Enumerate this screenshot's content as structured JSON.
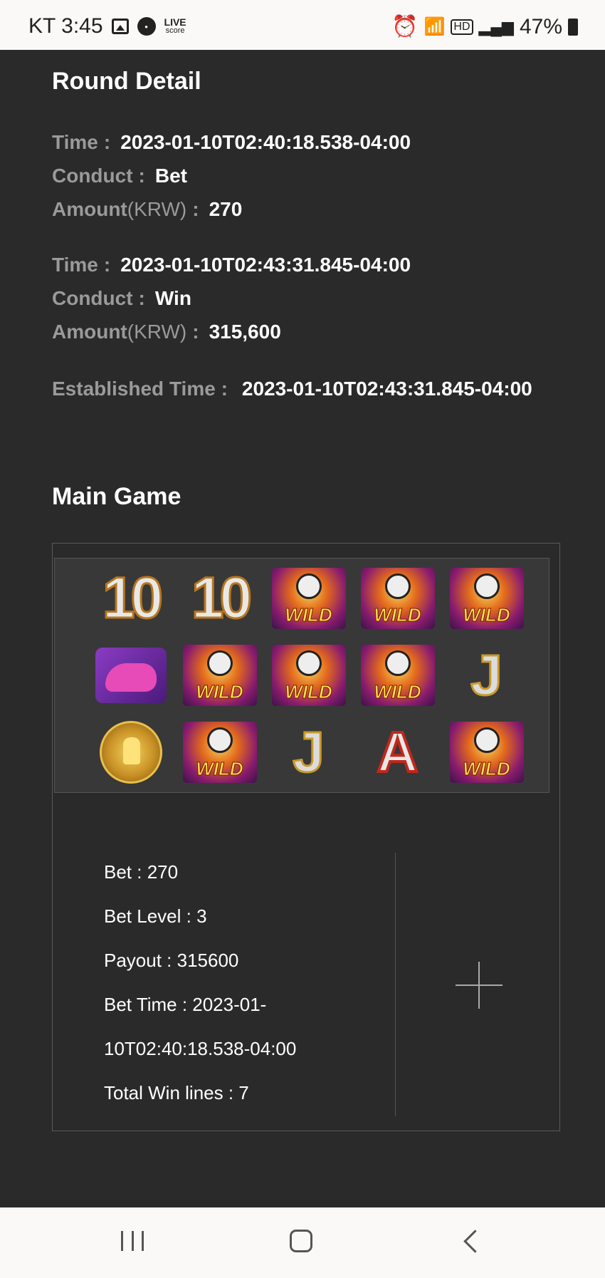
{
  "status_bar": {
    "time": "KT 3:45",
    "live_label": "LIVE",
    "live_sub": "score",
    "battery": "47%",
    "icons": [
      "gallery-icon",
      "app-icon",
      "live-score-icon",
      "alarm-icon",
      "wifi-icon",
      "hd-icon",
      "signal-icon",
      "battery-icon"
    ]
  },
  "round_detail": {
    "title": "Round Detail",
    "records": [
      {
        "time_label": "Time",
        "time": "2023-01-10T02:40:18.538-04:00",
        "conduct_label": "Conduct",
        "conduct": "Bet",
        "amount_label": "Amount",
        "amount_unit": "(KRW)",
        "amount": "270"
      },
      {
        "time_label": "Time",
        "time": "2023-01-10T02:43:31.845-04:00",
        "conduct_label": "Conduct",
        "conduct": "Win",
        "amount_label": "Amount",
        "amount_unit": "(KRW)",
        "amount": "315,600"
      }
    ],
    "established_label": "Established Time :",
    "established_time": "2023-01-10T02:43:31.845-04:00"
  },
  "main_game": {
    "title": "Main Game",
    "reels": [
      [
        "10",
        "10",
        "WILD",
        "WILD",
        "WILD"
      ],
      [
        "boot",
        "WILD",
        "WILD",
        "WILD",
        "J"
      ],
      [
        "trophy",
        "WILD",
        "J",
        "A",
        "WILD"
      ]
    ],
    "wild_text": "WILD",
    "info": {
      "bet": "Bet : 270",
      "bet_level": "Bet Level : 3",
      "payout": "Payout : 315600",
      "bet_time_1": "Bet Time : 2023-01-",
      "bet_time_2": "10T02:40:18.538-04:00",
      "win_lines": "Total Win lines : 7"
    }
  }
}
